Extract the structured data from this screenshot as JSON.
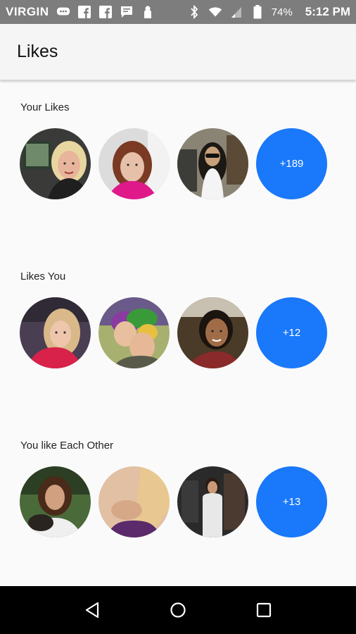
{
  "status_bar": {
    "carrier": "VIRGIN",
    "battery": "74%",
    "time": "5:12 PM",
    "icons_left": [
      "message-icon",
      "facebook-icon",
      "facebook-icon",
      "chat-icon",
      "notification-icon"
    ],
    "icons_right": [
      "bluetooth-icon",
      "wifi-icon",
      "signal-icon",
      "battery-icon"
    ]
  },
  "app_bar": {
    "title": "Likes"
  },
  "sections": [
    {
      "label": "Your Likes",
      "more": "+189"
    },
    {
      "label": "Likes You",
      "more": "+12"
    },
    {
      "label": "You like Each Other",
      "more": "+13"
    }
  ],
  "colors": {
    "accent": "#1a78fa",
    "status_bar": "#7d7d7d",
    "nav_bar": "#000000",
    "background": "#fafafa"
  },
  "nav_bar": {
    "icons": [
      "back-icon",
      "home-icon",
      "recents-icon"
    ]
  }
}
